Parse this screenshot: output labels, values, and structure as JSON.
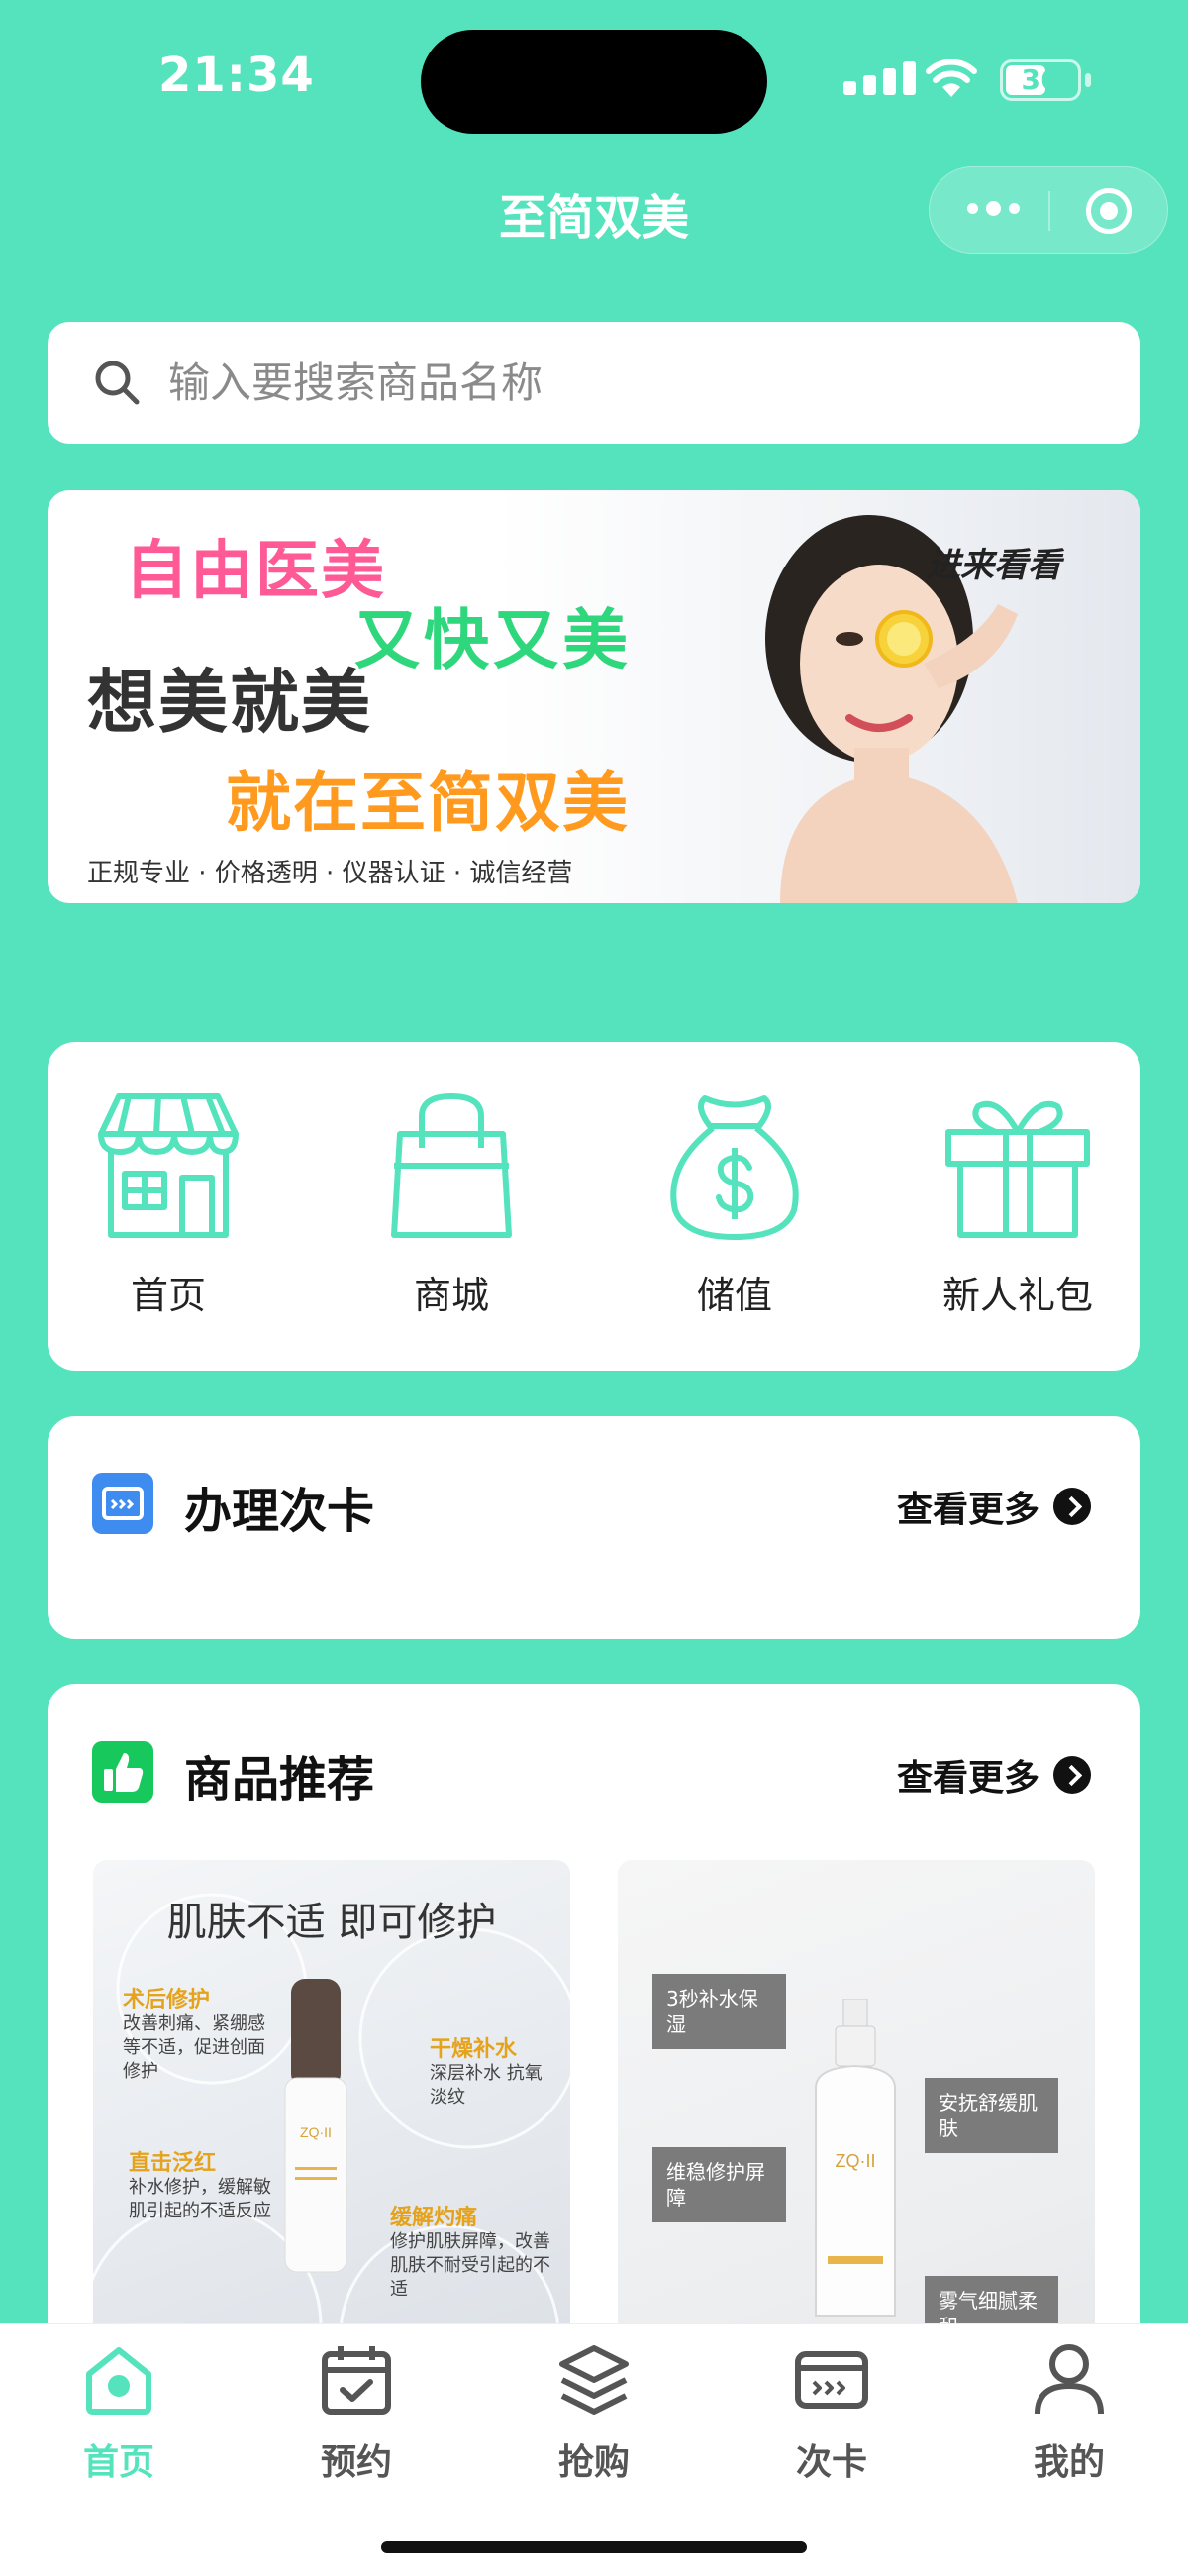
{
  "status_bar": {
    "time": "21:34",
    "battery": "36"
  },
  "nav": {
    "title": "至简双美"
  },
  "search": {
    "placeholder": "输入要搜索商品名称"
  },
  "banner": {
    "line1": "自由医美",
    "line2": "又快又美",
    "line3": "想美就美",
    "line4": "就在至简双美",
    "tagline": "正规专业 · 价格透明 · 仪器认证 · 诚信经营",
    "cta": "进来看看"
  },
  "quick_menu": [
    {
      "label": "首页",
      "icon": "store-icon"
    },
    {
      "label": "商城",
      "icon": "shopping-bag-icon"
    },
    {
      "label": "储值",
      "icon": "money-bag-icon"
    },
    {
      "label": "新人礼包",
      "icon": "gift-icon"
    }
  ],
  "card_section": {
    "title": "办理次卡",
    "more": "查看更多"
  },
  "products_section": {
    "title": "商品推荐",
    "more": "查看更多"
  },
  "products": [
    {
      "headline": "肌肤不适 即可修护",
      "brand": "ZQ·II",
      "points": [
        {
          "title": "术后修护",
          "text": "改善刺痛、紧绷感等不适，促进创面修护"
        },
        {
          "title": "干燥补水",
          "text": "深层补水 抗氧淡纹"
        },
        {
          "title": "直击泛红",
          "text": "补水修护，缓解敏肌引起的不适反应"
        },
        {
          "title": "缓解灼痛",
          "text": "修护肌肤屏障，改善肌肤不耐受引起的不适"
        }
      ]
    },
    {
      "brand": "ZQ·II",
      "boxes": [
        "3秒补水保湿",
        "安抚舒缓肌肤",
        "维稳修护屏障",
        "雾气细腻柔和"
      ]
    }
  ],
  "tabbar": [
    {
      "label": "首页",
      "icon": "home-icon",
      "active": true
    },
    {
      "label": "预约",
      "icon": "calendar-check-icon",
      "active": false
    },
    {
      "label": "抢购",
      "icon": "layers-icon",
      "active": false
    },
    {
      "label": "次卡",
      "icon": "card-icon",
      "active": false
    },
    {
      "label": "我的",
      "icon": "user-icon",
      "active": false
    }
  ],
  "colors": {
    "primary": "#55e3bd",
    "text": "#1a1a1a"
  }
}
